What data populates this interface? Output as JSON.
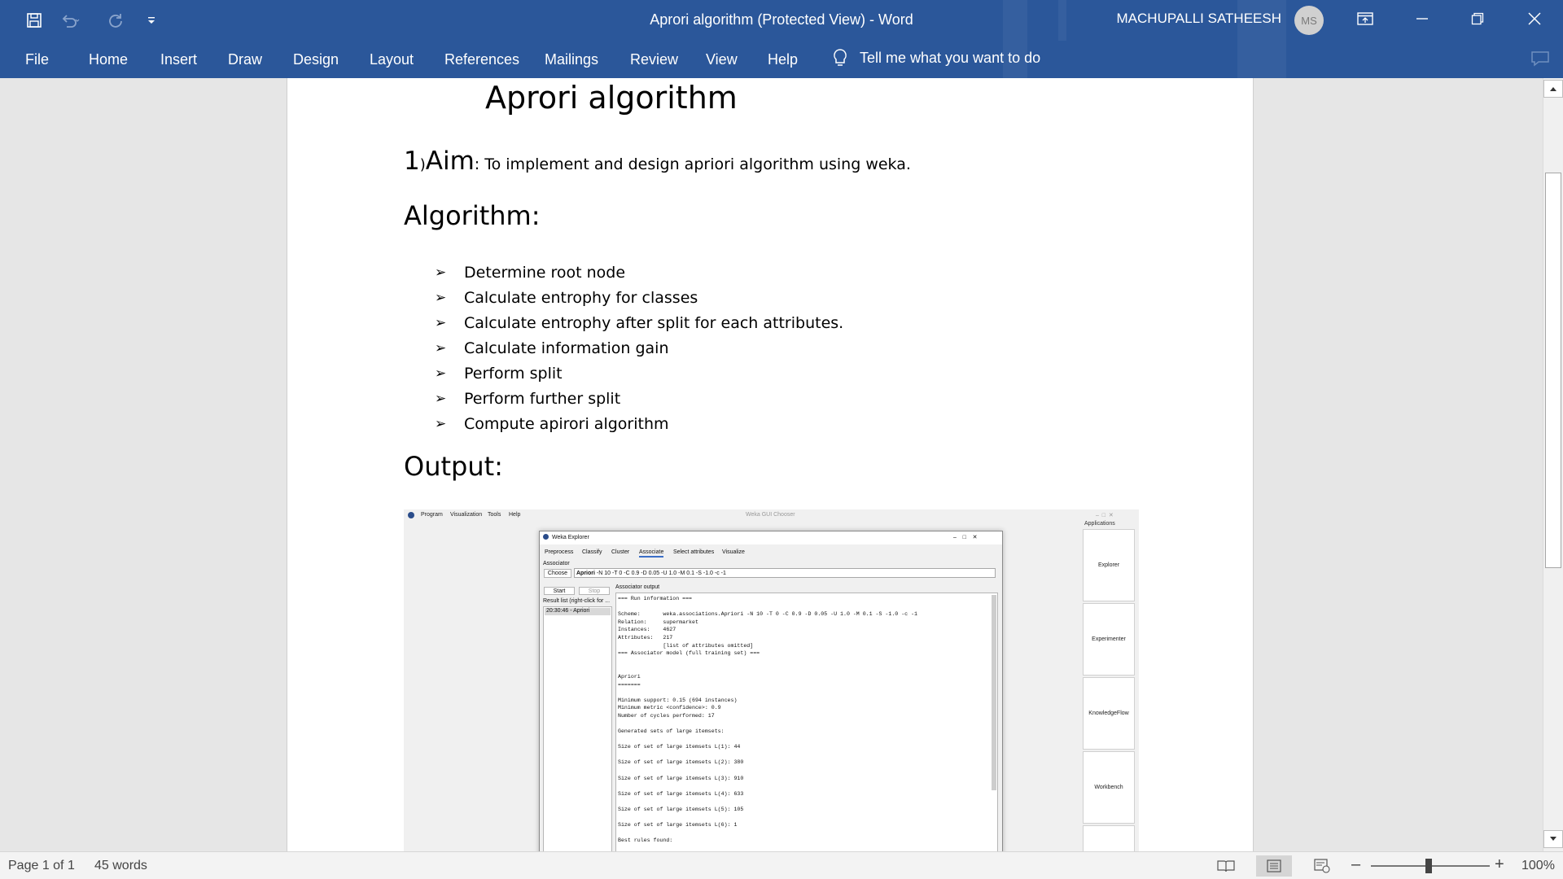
{
  "window": {
    "title": "Aprori algorithm (Protected View)  -  Word",
    "user_name": "MACHUPALLI SATHEESH",
    "user_initials": "MS"
  },
  "ribbon": {
    "tabs": [
      "File",
      "Home",
      "Insert",
      "Draw",
      "Design",
      "Layout",
      "References",
      "Mailings",
      "Review",
      "View",
      "Help"
    ],
    "tell_me": "Tell me what you want to do"
  },
  "document": {
    "title": "Aprori algorithm",
    "aim": {
      "number": "1",
      "paren": ")",
      "label": "Aim",
      "text": ": To implement and design apriori algorithm using weka."
    },
    "algorithm_heading": "Algorithm:",
    "steps": [
      "Determine root node",
      "Calculate entrophy for classes",
      "Calculate entrophy after split for each attributes.",
      "Calculate information gain",
      "Perform split",
      "Perform further split",
      "Compute apirori algorithm"
    ],
    "output_heading": "Output:"
  },
  "weka": {
    "menu": [
      "Program",
      "Visualization",
      "Tools",
      "Help"
    ],
    "chooser_title": "Weka GUI Chooser",
    "applications_label": "Applications",
    "applications": [
      "Explorer",
      "Experimenter",
      "KnowledgeFlow",
      "Workbench"
    ],
    "explorer_title": "Weka Explorer",
    "tabs": [
      "Preprocess",
      "Classify",
      "Cluster",
      "Associate",
      "Select attributes",
      "Visualize"
    ],
    "associator_label": "Associator",
    "choose_label": "Choose",
    "associator_name": "Apriori",
    "associator_options": "-N 10 -T 0 -C 0.9 -D 0.05 -U 1.0 -M 0.1 -S -1.0 -c -1",
    "start_label": "Start",
    "stop_label": "Stop",
    "result_list_label": "Result list (right-click for ...",
    "result_item": "20:30:46 - Apriori",
    "output_label": "Associator output",
    "output_text": "=== Run information ===\n\nScheme:       weka.associations.Apriori -N 10 -T 0 -C 0.9 -D 0.05 -U 1.0 -M 0.1 -S -1.0 -c -1\nRelation:     supermarket\nInstances:    4627\nAttributes:   217\n              [list of attributes omitted]\n=== Associator model (full training set) ===\n\n\nApriori\n=======\n\nMinimum support: 0.15 (694 instances)\nMinimum metric <confidence>: 0.9\nNumber of cycles performed: 17\n\nGenerated sets of large itemsets:\n\nSize of set of large itemsets L(1): 44\n\nSize of set of large itemsets L(2): 380\n\nSize of set of large itemsets L(3): 910\n\nSize of set of large itemsets L(4): 633\n\nSize of set of large itemsets L(5): 105\n\nSize of set of large itemsets L(6): 1\n\nBest rules found:"
  },
  "status": {
    "page": "Page 1 of 1",
    "words": "45 words",
    "zoom": "100%",
    "zoom_level": 1.0
  }
}
